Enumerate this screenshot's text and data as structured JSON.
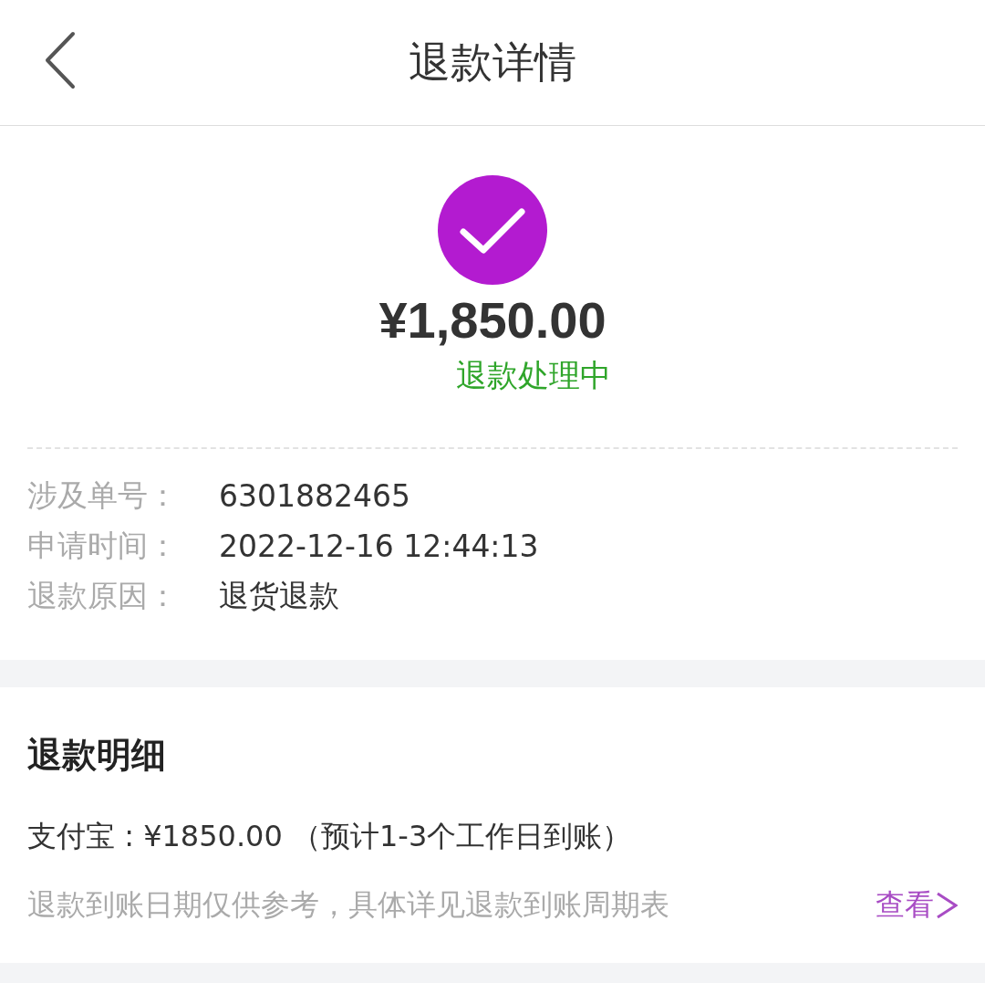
{
  "header": {
    "title": "退款详情"
  },
  "summary": {
    "amount": "¥1,850.00",
    "status": "退款处理中"
  },
  "info": [
    {
      "label": "涉及单号：",
      "value": "6301882465"
    },
    {
      "label": "申请时间：",
      "value": "2022-12-16 12:44:13"
    },
    {
      "label": "退款原因：",
      "value": "退货退款"
    }
  ],
  "details": {
    "heading": "退款明细",
    "line": "支付宝 : ¥1850.00 （预计1-3个工作日到账）",
    "note": "退款到账日期仅供参考，具体详见退款到账周期表",
    "link": "查看"
  }
}
